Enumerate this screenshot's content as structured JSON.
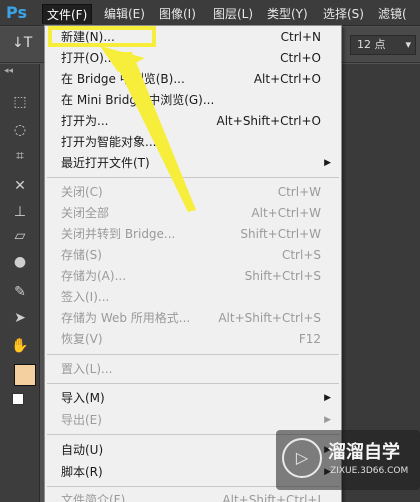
{
  "app": {
    "logo": "Ps"
  },
  "menubar": {
    "items": [
      "文件(F)",
      "编辑(E)",
      "图像(I)",
      "图层(L)",
      "类型(Y)",
      "选择(S)",
      "滤镜("
    ],
    "active_index": 0
  },
  "options": {
    "tool_glyph": "↓T",
    "font_size": "12 点"
  },
  "file_menu": {
    "items": [
      {
        "label": "新建(N)...",
        "shortcut": "Ctrl+N",
        "enabled": true,
        "submenu": false
      },
      {
        "label": "打开(O)...",
        "shortcut": "Ctrl+O",
        "enabled": true,
        "submenu": false
      },
      {
        "label": "在 Bridge 中浏览(B)...",
        "shortcut": "Alt+Ctrl+O",
        "enabled": true,
        "submenu": false
      },
      {
        "label": "在 Mini Bridge 中浏览(G)...",
        "shortcut": "",
        "enabled": true,
        "submenu": false
      },
      {
        "label": "打开为...",
        "shortcut": "Alt+Shift+Ctrl+O",
        "enabled": true,
        "submenu": false
      },
      {
        "label": "打开为智能对象...",
        "shortcut": "",
        "enabled": true,
        "submenu": false
      },
      {
        "label": "最近打开文件(T)",
        "shortcut": "",
        "enabled": true,
        "submenu": true
      },
      {
        "label": "关闭(C)",
        "shortcut": "Ctrl+W",
        "enabled": false,
        "submenu": false
      },
      {
        "label": "关闭全部",
        "shortcut": "Alt+Ctrl+W",
        "enabled": false,
        "submenu": false
      },
      {
        "label": "关闭并转到 Bridge...",
        "shortcut": "Shift+Ctrl+W",
        "enabled": false,
        "submenu": false
      },
      {
        "label": "存储(S)",
        "shortcut": "Ctrl+S",
        "enabled": false,
        "submenu": false
      },
      {
        "label": "存储为(A)...",
        "shortcut": "Shift+Ctrl+S",
        "enabled": false,
        "submenu": false
      },
      {
        "label": "签入(I)...",
        "shortcut": "",
        "enabled": false,
        "submenu": false
      },
      {
        "label": "存储为 Web 所用格式...",
        "shortcut": "Alt+Shift+Ctrl+S",
        "enabled": false,
        "submenu": false
      },
      {
        "label": "恢复(V)",
        "shortcut": "F12",
        "enabled": false,
        "submenu": false
      },
      {
        "label": "置入(L)...",
        "shortcut": "",
        "enabled": false,
        "submenu": false
      },
      {
        "label": "导入(M)",
        "shortcut": "",
        "enabled": true,
        "submenu": true
      },
      {
        "label": "导出(E)",
        "shortcut": "",
        "enabled": false,
        "submenu": true
      },
      {
        "label": "自动(U)",
        "shortcut": "",
        "enabled": true,
        "submenu": true
      },
      {
        "label": "脚本(R)",
        "shortcut": "",
        "enabled": true,
        "submenu": true
      },
      {
        "label": "文件简介(F)...",
        "shortcut": "Alt+Shift+Ctrl+I",
        "enabled": false,
        "submenu": false
      }
    ],
    "highlighted": "新建(N)..."
  },
  "watermark": {
    "title": "溜溜自学",
    "subtitle": "ZIXUE.3D66.COM"
  },
  "colors": {
    "foreground_swatch": "#f4cfa0",
    "highlight": "#f6ee3a",
    "menu_bg": "#f0f0f0"
  }
}
